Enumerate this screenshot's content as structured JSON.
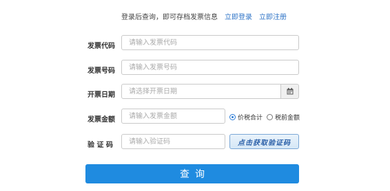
{
  "notice": {
    "text": "登录后查询，即可存档发票信息",
    "login_link": "立即登录",
    "register_link": "立即注册"
  },
  "form": {
    "invoice_code": {
      "label": "发票代码",
      "placeholder": "请输入发票代码"
    },
    "invoice_number": {
      "label": "发票号码",
      "placeholder": "请输入发票号码"
    },
    "invoice_date": {
      "label": "开票日期",
      "placeholder": "请选择开票日期",
      "calendar_icon": "calendar-icon"
    },
    "invoice_amount": {
      "label": "发票金额",
      "placeholder": "请输入发票金额",
      "amount_type_options": [
        {
          "label": "价税合计",
          "selected": true
        },
        {
          "label": "税前金额",
          "selected": false
        }
      ]
    },
    "captcha": {
      "label": "验 证 码",
      "placeholder": "请输入验证码",
      "button_label": "点击获取验证码"
    },
    "submit_label": "查询"
  },
  "colors": {
    "primary": "#1f8be0",
    "link": "#2f74c7",
    "border": "#c9c9c9"
  }
}
